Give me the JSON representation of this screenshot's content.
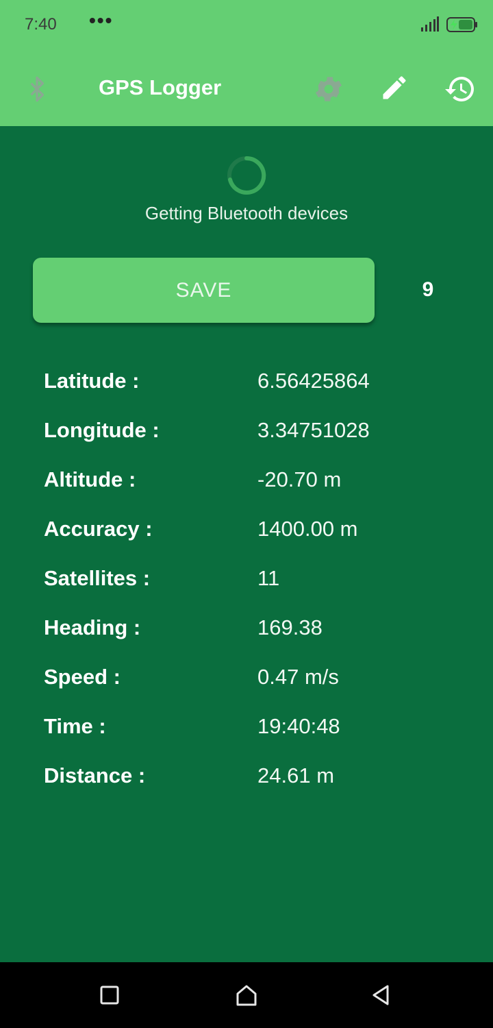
{
  "status_bar": {
    "time": "7:40",
    "dots": "•••",
    "icons": [
      "signal-icon",
      "battery-charging-icon"
    ]
  },
  "app_bar": {
    "title": "GPS Logger",
    "color": "#64cf73",
    "icons": [
      "bluetooth-icon",
      "settings-icon",
      "edit-icon",
      "history-icon"
    ]
  },
  "main": {
    "background": "#0a6e3e",
    "status_message": "Getting Bluetooth devices",
    "save_label": "SAVE",
    "count": "9",
    "info": [
      {
        "label": "Latitude :",
        "value": "6.56425864"
      },
      {
        "label": "Longitude :",
        "value": "3.34751028"
      },
      {
        "label": "Altitude :",
        "value": "-20.70 m"
      },
      {
        "label": "Accuracy :",
        "value": "1400.00 m"
      },
      {
        "label": "Satellites :",
        "value": "11"
      },
      {
        "label": "Heading :",
        "value": "169.38"
      },
      {
        "label": "Speed :",
        "value": "0.47 m/s"
      },
      {
        "label": "Time :",
        "value": "19:40:48"
      },
      {
        "label": "Distance :",
        "value": "24.61 m"
      }
    ]
  },
  "nav_bar": {
    "icons": [
      "recents-icon",
      "home-icon",
      "back-icon"
    ]
  }
}
